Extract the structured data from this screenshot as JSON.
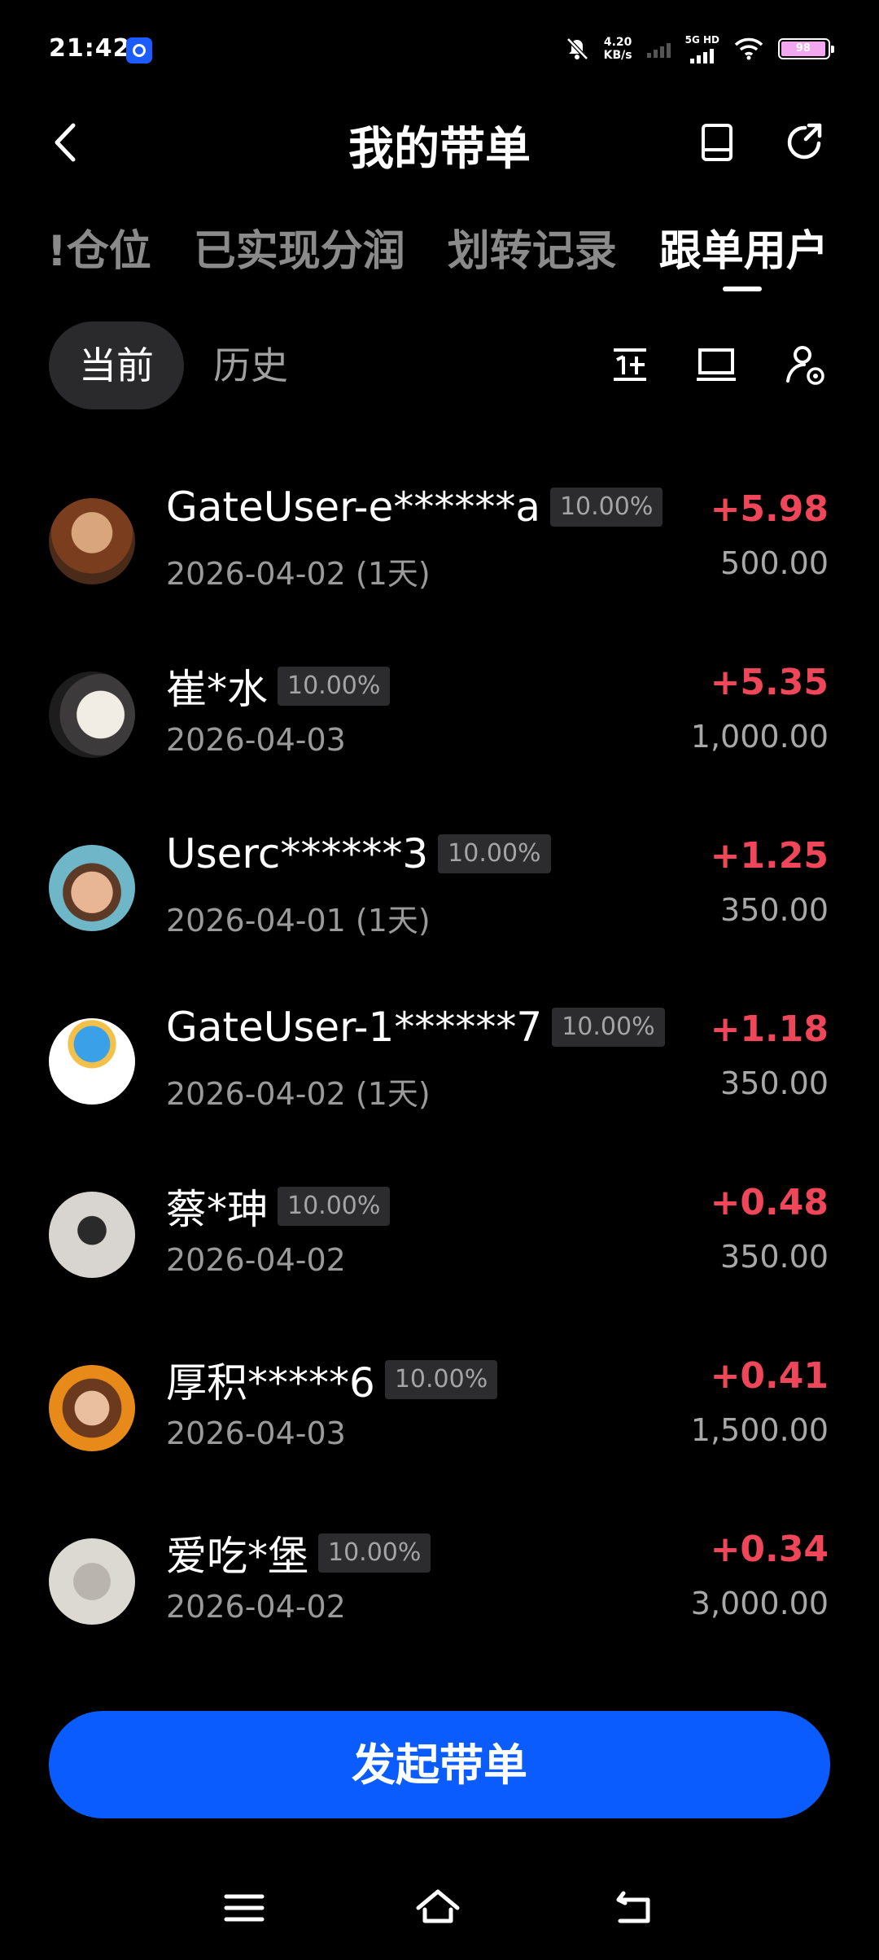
{
  "status_bar": {
    "time": "21:42",
    "net_speed_value": "4.20",
    "net_speed_unit": "KB/s",
    "network_label": "5G HD",
    "battery": "98"
  },
  "header": {
    "title": "我的带单"
  },
  "tabs": [
    {
      "label": "!仓位"
    },
    {
      "label": "已实现分润"
    },
    {
      "label": "划转记录"
    },
    {
      "label": "跟单用户"
    }
  ],
  "segments": {
    "current": "当前",
    "history": "历史"
  },
  "followers": [
    {
      "name": "GateUser-e******a",
      "ratio": "10.00%",
      "date": "2026-04-02 (1天)",
      "profit": "+5.98",
      "amount": "500.00"
    },
    {
      "name": "崔*水",
      "ratio": "10.00%",
      "date": "2026-04-03",
      "profit": "+5.35",
      "amount": "1,000.00"
    },
    {
      "name": "Userc******3",
      "ratio": "10.00%",
      "date": "2026-04-01 (1天)",
      "profit": "+1.25",
      "amount": "350.00"
    },
    {
      "name": "GateUser-1******7",
      "ratio": "10.00%",
      "date": "2026-04-02 (1天)",
      "profit": "+1.18",
      "amount": "350.00"
    },
    {
      "name": "蔡*珅",
      "ratio": "10.00%",
      "date": "2026-04-02",
      "profit": "+0.48",
      "amount": "350.00"
    },
    {
      "name": "厚积*****6",
      "ratio": "10.00%",
      "date": "2026-04-03",
      "profit": "+0.41",
      "amount": "1,500.00"
    },
    {
      "name": "爱吃*堡",
      "ratio": "10.00%",
      "date": "2026-04-02",
      "profit": "+0.34",
      "amount": "3,000.00"
    }
  ],
  "cta": {
    "label": "发起带单"
  },
  "colors": {
    "accent": "#0a5cff",
    "profit": "#f0465a",
    "background": "#000000"
  }
}
